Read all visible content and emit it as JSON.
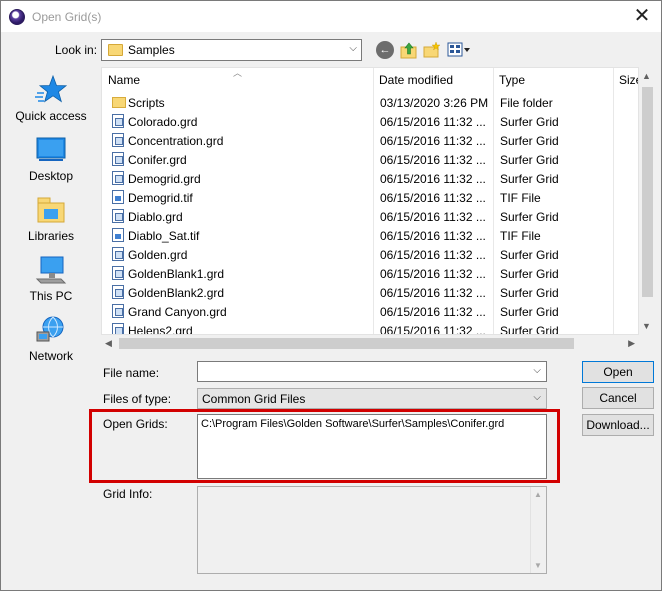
{
  "window": {
    "title": "Open Grid(s)"
  },
  "lookin": {
    "label": "Look in:",
    "value": "Samples"
  },
  "places": [
    {
      "label": "Quick access",
      "icon": "star-icon"
    },
    {
      "label": "Desktop",
      "icon": "desktop-icon"
    },
    {
      "label": "Libraries",
      "icon": "libraries-icon"
    },
    {
      "label": "This PC",
      "icon": "computer-icon"
    },
    {
      "label": "Network",
      "icon": "network-icon"
    }
  ],
  "columns": {
    "name": "Name",
    "date": "Date modified",
    "type": "Type",
    "size": "Size"
  },
  "files": [
    {
      "name": "Scripts",
      "date": "03/13/2020 3:26 PM",
      "type": "File folder",
      "icon": "folder"
    },
    {
      "name": "Colorado.grd",
      "date": "06/15/2016 11:32 ...",
      "type": "Surfer Grid",
      "icon": "grd"
    },
    {
      "name": "Concentration.grd",
      "date": "06/15/2016 11:32 ...",
      "type": "Surfer Grid",
      "icon": "grd"
    },
    {
      "name": "Conifer.grd",
      "date": "06/15/2016 11:32 ...",
      "type": "Surfer Grid",
      "icon": "grd"
    },
    {
      "name": "Demogrid.grd",
      "date": "06/15/2016 11:32 ...",
      "type": "Surfer Grid",
      "icon": "grd"
    },
    {
      "name": "Demogrid.tif",
      "date": "06/15/2016 11:32 ...",
      "type": "TIF File",
      "icon": "tif"
    },
    {
      "name": "Diablo.grd",
      "date": "06/15/2016 11:32 ...",
      "type": "Surfer Grid",
      "icon": "grd"
    },
    {
      "name": "Diablo_Sat.tif",
      "date": "06/15/2016 11:32 ...",
      "type": "TIF File",
      "icon": "tif"
    },
    {
      "name": "Golden.grd",
      "date": "06/15/2016 11:32 ...",
      "type": "Surfer Grid",
      "icon": "grd"
    },
    {
      "name": "GoldenBlank1.grd",
      "date": "06/15/2016 11:32 ...",
      "type": "Surfer Grid",
      "icon": "grd"
    },
    {
      "name": "GoldenBlank2.grd",
      "date": "06/15/2016 11:32 ...",
      "type": "Surfer Grid",
      "icon": "grd"
    },
    {
      "name": "Grand Canyon.grd",
      "date": "06/15/2016 11:32 ...",
      "type": "Surfer Grid",
      "icon": "grd"
    },
    {
      "name": "Helens2.grd",
      "date": "06/15/2016 11:32 ...",
      "type": "Surfer Grid",
      "icon": "grd"
    }
  ],
  "form": {
    "filename_label": "File name:",
    "filename_value": "",
    "filetype_label": "Files of type:",
    "filetype_value": "Common Grid Files",
    "open_grids_label": "Open Grids:",
    "open_grids_value": "C:\\Program Files\\Golden Software\\Surfer\\Samples\\Conifer.grd",
    "grid_info_label": "Grid Info:",
    "grid_info_value": ""
  },
  "buttons": {
    "open": "Open",
    "cancel": "Cancel",
    "download": "Download..."
  },
  "colors": {
    "highlight": "#d20000",
    "default_button_border": "#0078d7"
  }
}
